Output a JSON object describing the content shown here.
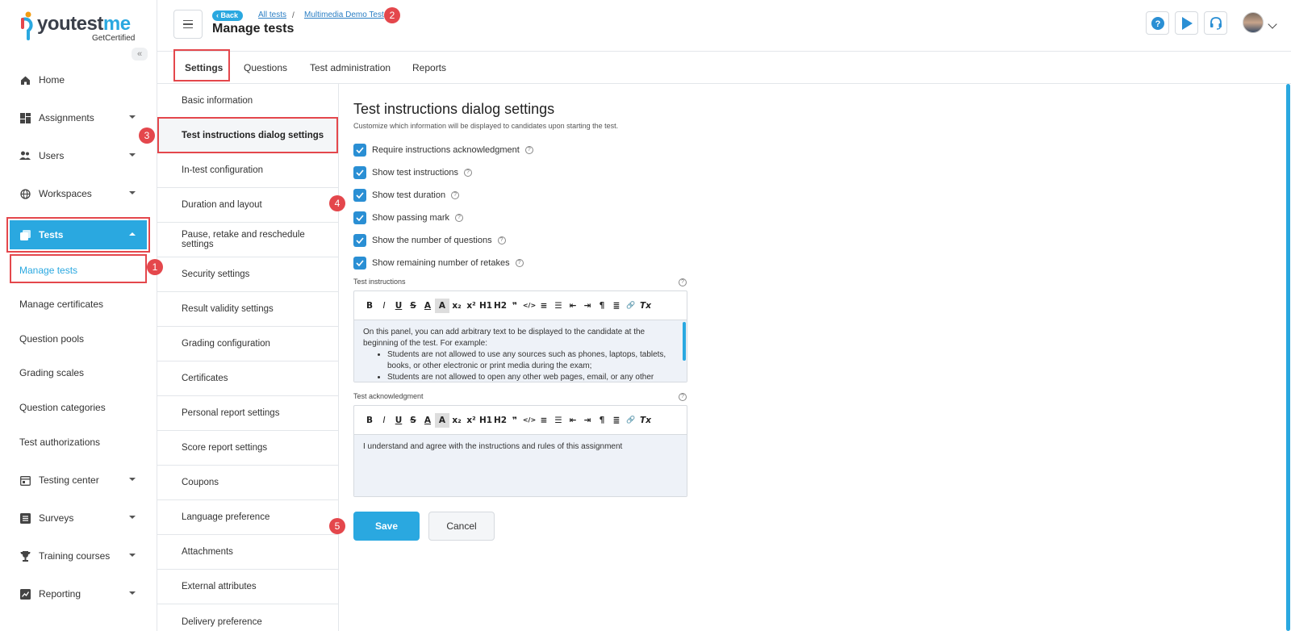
{
  "brand": {
    "name_part1": "youtest",
    "name_part2": "me",
    "tagline": "GetCertified",
    "accent_color": "#2aa8e0",
    "highlight_color": "#e4474c"
  },
  "sidebar": {
    "collapse_icon": "double-chevron-left-icon",
    "items": [
      {
        "label": "Home",
        "icon": "home-icon"
      },
      {
        "label": "Assignments",
        "icon": "dashboard-icon"
      },
      {
        "label": "Users",
        "icon": "users-icon"
      },
      {
        "label": "Workspaces",
        "icon": "globe-icon"
      },
      {
        "label": "Tests",
        "icon": "tests-icon"
      },
      {
        "label": "Testing center",
        "icon": "calendar-icon"
      },
      {
        "label": "Surveys",
        "icon": "list-icon"
      },
      {
        "label": "Training courses",
        "icon": "trophy-icon"
      },
      {
        "label": "Reporting",
        "icon": "chart-icon"
      }
    ],
    "tests_subitems": [
      "Manage tests",
      "Manage certificates",
      "Question pools",
      "Grading scales",
      "Question categories",
      "Test authorizations"
    ]
  },
  "header": {
    "back_label": "Back",
    "breadcrumb_all": "All tests",
    "breadcrumb_sep": "/",
    "breadcrumb_current": "Multimedia Demo Test",
    "page_title": "Manage tests",
    "icons": [
      "help-icon",
      "play-icon",
      "headset-icon"
    ]
  },
  "tabs": [
    "Settings",
    "Questions",
    "Test administration",
    "Reports"
  ],
  "sections": [
    "Basic information",
    "Test instructions dialog settings",
    "In-test configuration",
    "Duration and layout",
    "Pause, retake and reschedule settings",
    "Security settings",
    "Result validity settings",
    "Grading configuration",
    "Certificates",
    "Personal report settings",
    "Score report settings",
    "Coupons",
    "Language preference",
    "Attachments",
    "External attributes",
    "Delivery preference"
  ],
  "main": {
    "title": "Test instructions dialog settings",
    "subtitle": "Customize which information will be displayed to candidates upon starting the test.",
    "checkboxes": [
      {
        "label": "Require instructions acknowledgment",
        "checked": true
      },
      {
        "label": "Show test instructions",
        "checked": true
      },
      {
        "label": "Show test duration",
        "checked": true
      },
      {
        "label": "Show passing mark",
        "checked": true
      },
      {
        "label": "Show the number of questions",
        "checked": true
      },
      {
        "label": "Show remaining number of retakes",
        "checked": true
      }
    ],
    "instructions_label": "Test instructions",
    "instructions_intro": "On this panel, you can add arbitrary text to be displayed to the candidate at the beginning of the test. For example:",
    "instructions_bullets": [
      "Students are not allowed to use any sources such as phones, laptops, tablets, books, or other electronic or print media during the exam;",
      "Students are not allowed to open any other web pages, email, or any other"
    ],
    "acknowledgment_label": "Test acknowledgment",
    "acknowledgment_text": "I understand and agree with the instructions and rules of this assignment",
    "save_label": "Save",
    "cancel_label": "Cancel"
  },
  "toolbar_glyphs": [
    "B",
    "I",
    "U",
    "S",
    "A",
    "A",
    "x₂",
    "x²",
    "H1",
    "H2",
    "❞",
    "</>",
    "≡",
    "☰",
    "⇤",
    "⇥",
    "¶",
    "≣",
    "🔗",
    "Tx"
  ],
  "markers": [
    "1",
    "2",
    "3",
    "4",
    "5"
  ]
}
